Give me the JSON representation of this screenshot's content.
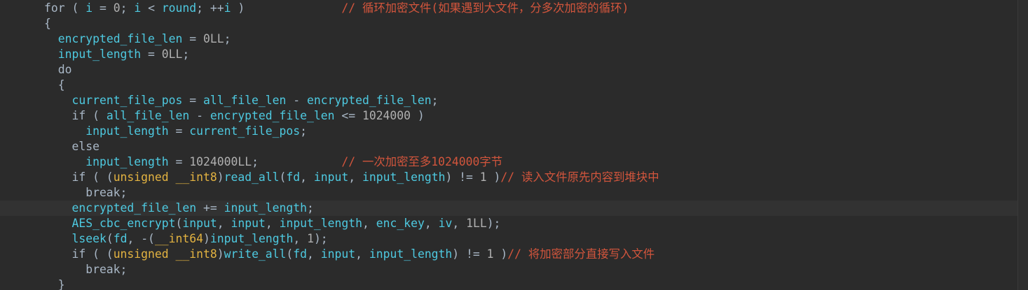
{
  "code_lines": [
    [
      {
        "t": "for ( ",
        "c": "kw"
      },
      {
        "t": "i",
        "c": "var"
      },
      {
        "t": " = ",
        "c": "pun"
      },
      {
        "t": "0",
        "c": "num"
      },
      {
        "t": "; ",
        "c": "pun"
      },
      {
        "t": "i",
        "c": "var"
      },
      {
        "t": " < ",
        "c": "pun"
      },
      {
        "t": "round",
        "c": "var"
      },
      {
        "t": "; ++",
        "c": "pun"
      },
      {
        "t": "i",
        "c": "var"
      },
      {
        "t": " )              ",
        "c": "pun"
      },
      {
        "t": "// 循环加密文件(如果遇到大文件，分多次加密的循环)",
        "c": "cmt"
      }
    ],
    [
      {
        "t": "{",
        "c": "pun"
      }
    ],
    [
      {
        "t": "  ",
        "c": "pun"
      },
      {
        "t": "encrypted_file_len",
        "c": "var"
      },
      {
        "t": " = ",
        "c": "pun"
      },
      {
        "t": "0LL",
        "c": "num"
      },
      {
        "t": ";",
        "c": "pun"
      }
    ],
    [
      {
        "t": "  ",
        "c": "pun"
      },
      {
        "t": "input_length",
        "c": "var"
      },
      {
        "t": " = ",
        "c": "pun"
      },
      {
        "t": "0LL",
        "c": "num"
      },
      {
        "t": ";",
        "c": "pun"
      }
    ],
    [
      {
        "t": "  do",
        "c": "kw"
      }
    ],
    [
      {
        "t": "  {",
        "c": "pun"
      }
    ],
    [
      {
        "t": "    ",
        "c": "pun"
      },
      {
        "t": "current_file_pos",
        "c": "var"
      },
      {
        "t": " = ",
        "c": "pun"
      },
      {
        "t": "all_file_len",
        "c": "var"
      },
      {
        "t": " - ",
        "c": "pun"
      },
      {
        "t": "encrypted_file_len",
        "c": "var"
      },
      {
        "t": ";",
        "c": "pun"
      }
    ],
    [
      {
        "t": "    if ( ",
        "c": "kw"
      },
      {
        "t": "all_file_len",
        "c": "var"
      },
      {
        "t": " - ",
        "c": "pun"
      },
      {
        "t": "encrypted_file_len",
        "c": "var"
      },
      {
        "t": " <= ",
        "c": "pun"
      },
      {
        "t": "1024000",
        "c": "num"
      },
      {
        "t": " )",
        "c": "pun"
      }
    ],
    [
      {
        "t": "      ",
        "c": "pun"
      },
      {
        "t": "input_length",
        "c": "var"
      },
      {
        "t": " = ",
        "c": "pun"
      },
      {
        "t": "current_file_pos",
        "c": "var"
      },
      {
        "t": ";",
        "c": "pun"
      }
    ],
    [
      {
        "t": "    else",
        "c": "kw"
      }
    ],
    [
      {
        "t": "      ",
        "c": "pun"
      },
      {
        "t": "input_length",
        "c": "var"
      },
      {
        "t": " = ",
        "c": "pun"
      },
      {
        "t": "1024000LL",
        "c": "num"
      },
      {
        "t": ";            ",
        "c": "pun"
      },
      {
        "t": "// 一次加密至多1024000字节",
        "c": "cmt"
      }
    ],
    [
      {
        "t": "    if ( (",
        "c": "kw"
      },
      {
        "t": "unsigned __int8",
        "c": "typ"
      },
      {
        "t": ")",
        "c": "pun"
      },
      {
        "t": "read_all",
        "c": "fn"
      },
      {
        "t": "(",
        "c": "pun"
      },
      {
        "t": "fd",
        "c": "var"
      },
      {
        "t": ", ",
        "c": "pun"
      },
      {
        "t": "input",
        "c": "var"
      },
      {
        "t": ", ",
        "c": "pun"
      },
      {
        "t": "input_length",
        "c": "var"
      },
      {
        "t": ") != ",
        "c": "pun"
      },
      {
        "t": "1",
        "c": "num"
      },
      {
        "t": " )",
        "c": "pun"
      },
      {
        "t": "// 读入文件原先内容到堆块中",
        "c": "cmt"
      }
    ],
    [
      {
        "t": "      break;",
        "c": "kw"
      }
    ],
    [
      {
        "t": "    ",
        "c": "pun"
      },
      {
        "t": "encrypted_file_len",
        "c": "var"
      },
      {
        "t": " += ",
        "c": "pun"
      },
      {
        "t": "input_length",
        "c": "var"
      },
      {
        "t": ";",
        "c": "pun"
      }
    ],
    [
      {
        "t": "    ",
        "c": "pun"
      },
      {
        "t": "AES_cbc_encrypt",
        "c": "fn"
      },
      {
        "t": "(",
        "c": "pun"
      },
      {
        "t": "input",
        "c": "var"
      },
      {
        "t": ", ",
        "c": "pun"
      },
      {
        "t": "input",
        "c": "var"
      },
      {
        "t": ", ",
        "c": "pun"
      },
      {
        "t": "input_length",
        "c": "var"
      },
      {
        "t": ", ",
        "c": "pun"
      },
      {
        "t": "enc_key",
        "c": "var"
      },
      {
        "t": ", ",
        "c": "pun"
      },
      {
        "t": "iv",
        "c": "var"
      },
      {
        "t": ", ",
        "c": "pun"
      },
      {
        "t": "1LL",
        "c": "num"
      },
      {
        "t": ");",
        "c": "pun"
      }
    ],
    [
      {
        "t": "    ",
        "c": "pun"
      },
      {
        "t": "lseek",
        "c": "fn"
      },
      {
        "t": "(",
        "c": "pun"
      },
      {
        "t": "fd",
        "c": "var"
      },
      {
        "t": ", -(",
        "c": "pun"
      },
      {
        "t": "__int64",
        "c": "typ"
      },
      {
        "t": ")",
        "c": "pun"
      },
      {
        "t": "input_length",
        "c": "var"
      },
      {
        "t": ", ",
        "c": "pun"
      },
      {
        "t": "1",
        "c": "num"
      },
      {
        "t": ");",
        "c": "pun"
      }
    ],
    [
      {
        "t": "    if ( (",
        "c": "kw"
      },
      {
        "t": "unsigned __int8",
        "c": "typ"
      },
      {
        "t": ")",
        "c": "pun"
      },
      {
        "t": "write_all",
        "c": "fn"
      },
      {
        "t": "(",
        "c": "pun"
      },
      {
        "t": "fd",
        "c": "var"
      },
      {
        "t": ", ",
        "c": "pun"
      },
      {
        "t": "input",
        "c": "var"
      },
      {
        "t": ", ",
        "c": "pun"
      },
      {
        "t": "input_length",
        "c": "var"
      },
      {
        "t": ") != ",
        "c": "pun"
      },
      {
        "t": "1",
        "c": "num"
      },
      {
        "t": " )",
        "c": "pun"
      },
      {
        "t": "// 将加密部分直接写入文件",
        "c": "cmt"
      }
    ],
    [
      {
        "t": "      break;",
        "c": "kw"
      }
    ],
    [
      {
        "t": "  }",
        "c": "pun"
      }
    ]
  ],
  "current_line": 13,
  "colors": {
    "background": "#2b2b2b",
    "current_line": "#323232",
    "identifier": "#4ec9e0",
    "keyword": "#a9b7c6",
    "type": "#e3b341",
    "comment": "#d2553c",
    "number": "#b0b0b0"
  }
}
